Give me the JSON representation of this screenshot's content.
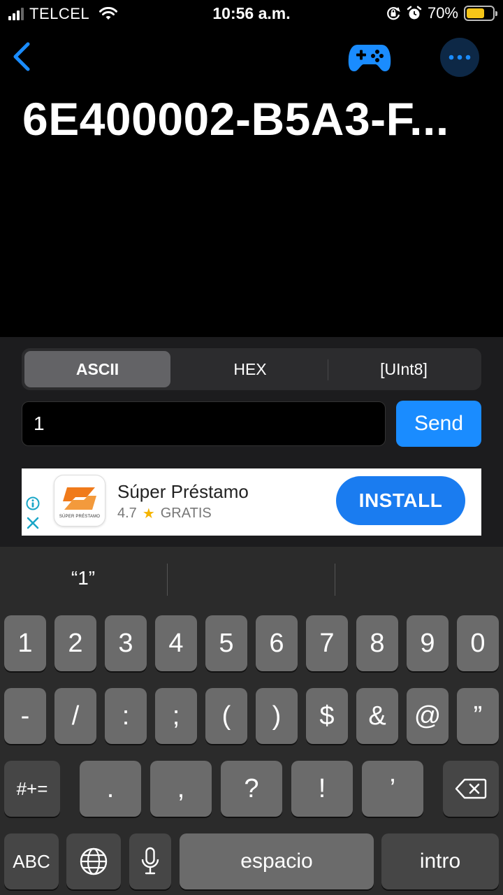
{
  "status_bar": {
    "carrier": "TELCEL",
    "time": "10:56 a.m.",
    "battery_percent": "70%",
    "battery_level": 0.7,
    "battery_color": "#f5c518",
    "icons": [
      "signal-icon",
      "wifi-icon",
      "orientation-lock-icon",
      "alarm-icon",
      "battery-icon"
    ]
  },
  "nav": {
    "back_icon": "chevron-left-icon",
    "gamepad_icon": "gamepad-icon",
    "more_icon": "ellipsis-icon"
  },
  "page_title": "6E400002-B5A3-F...",
  "format_tabs": {
    "options": [
      "ASCII",
      "HEX",
      "[UInt8]"
    ],
    "selected": "ASCII"
  },
  "message_input": {
    "value": "1"
  },
  "send_label": "Send",
  "ad": {
    "app_name": "Súper Préstamo",
    "rating": "4.7",
    "price": "GRATIS",
    "logo_text": "SÚPER PRÉSTAMO",
    "install_label": "INSTALL",
    "info_icon": "info-icon",
    "close_icon": "close-icon"
  },
  "keyboard": {
    "suggestions": [
      "“1”",
      "",
      ""
    ],
    "row1": [
      "1",
      "2",
      "3",
      "4",
      "5",
      "6",
      "7",
      "8",
      "9",
      "0"
    ],
    "row2": [
      "-",
      "/",
      ":",
      ";",
      "(",
      ")",
      "$",
      "&",
      "@",
      "”"
    ],
    "shift_label": "#+=",
    "row3": [
      ".",
      ",",
      "?",
      "!",
      "’"
    ],
    "abc_label": "ABC",
    "space_label": "espacio",
    "return_label": "intro",
    "accent_color": "#1a8cff"
  }
}
